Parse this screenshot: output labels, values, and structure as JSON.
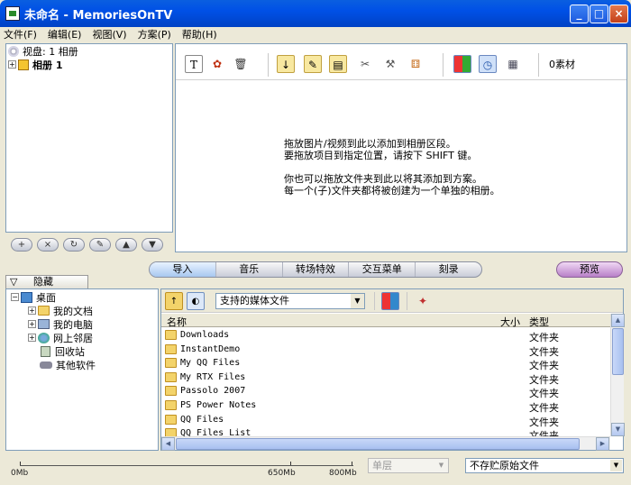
{
  "window": {
    "title": "未命名 - MemoriesOnTV",
    "min_label": "_",
    "max_label": "□",
    "close_label": "×"
  },
  "menu": [
    "文件(F)",
    "编辑(E)",
    "视图(V)",
    "方案(P)",
    "帮助(H)"
  ],
  "album_tree": {
    "disc_label": "视盘: 1 相册",
    "album_label": "相册 1"
  },
  "album_buttons": [
    "+",
    "×",
    "↻",
    "✎",
    "▲",
    "▼"
  ],
  "toolbar": {
    "media_count": "0素材"
  },
  "drop_hint": {
    "line1": "拖放图片/视频到此以添加到相册区段。",
    "line2": "要拖放项目到指定位置，请按下 SHIFT 键。",
    "line3": "你也可以拖放文件夹到此以将其添加到方案。",
    "line4": "每一个(子)文件夹都将被创建为一个单独的相册。"
  },
  "tabs": [
    "导入",
    "音乐",
    "转场特效",
    "交互菜单",
    "刻录"
  ],
  "preview_label": "预览",
  "hide_tab_label": "隐藏",
  "folder_tree": {
    "root": "桌面",
    "items": [
      "我的文档",
      "我的电脑",
      "网上邻居",
      "回收站",
      "其他软件"
    ]
  },
  "file_browser": {
    "filter_value": "支持的媒体文件",
    "columns": {
      "name": "名称",
      "size": "大小",
      "type": "类型"
    },
    "files": [
      {
        "name": "Downloads",
        "type": "文件夹"
      },
      {
        "name": "InstantDemo",
        "type": "文件夹"
      },
      {
        "name": "My QQ Files",
        "type": "文件夹"
      },
      {
        "name": "My RTX Files",
        "type": "文件夹"
      },
      {
        "name": "Passolo 2007",
        "type": "文件夹"
      },
      {
        "name": "PS Power Notes",
        "type": "文件夹"
      },
      {
        "name": "QQ Files",
        "type": "文件夹"
      },
      {
        "name": "QQ Files List",
        "type": "文件夹"
      }
    ]
  },
  "status": {
    "cap_0": "0Mb",
    "cap_650": "650Mb",
    "cap_800": "800Mb",
    "layer_value": "单层",
    "save_value": "不存贮原始文件"
  }
}
